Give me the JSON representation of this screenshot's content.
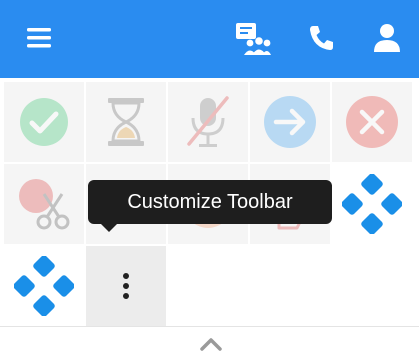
{
  "header": {
    "background": "#2a8cf0",
    "icons": [
      "menu-icon",
      "group-chat-icon",
      "phone-icon",
      "user-icon"
    ]
  },
  "toolbar": {
    "buttons": [
      {
        "name": "ready-button",
        "icon": "check-circle-icon",
        "color": "#43c97a"
      },
      {
        "name": "wait-button",
        "icon": "hourglass-icon",
        "color": "#8a8a8a"
      },
      {
        "name": "mute-button",
        "icon": "microphone-off-icon",
        "color": "#e05555"
      },
      {
        "name": "transfer-button",
        "icon": "arrow-right-circle-icon",
        "color": "#4aa8f0"
      },
      {
        "name": "end-button",
        "icon": "close-circle-icon",
        "color": "#e8504a"
      },
      {
        "name": "disconnect-button",
        "icon": "scissors-icon",
        "color": "#e05555"
      },
      {
        "name": "hidden-button-1",
        "icon": "generic-icon"
      },
      {
        "name": "hidden-button-2",
        "icon": "generic-icon",
        "color": "#f4a37a"
      },
      {
        "name": "hidden-button-3",
        "icon": "hand-icon",
        "color": "#e05555"
      },
      {
        "name": "app-button-1",
        "icon": "diamond-grid-icon",
        "color": "#1a8fe8"
      },
      {
        "name": "app-button-2",
        "icon": "diamond-grid-icon",
        "color": "#1a8fe8"
      },
      {
        "name": "more-button",
        "icon": "vertical-dots-icon",
        "color": "#222222"
      }
    ]
  },
  "tooltip": {
    "text": "Customize Toolbar"
  },
  "footer": {
    "collapse_icon": "chevron-up-icon"
  }
}
